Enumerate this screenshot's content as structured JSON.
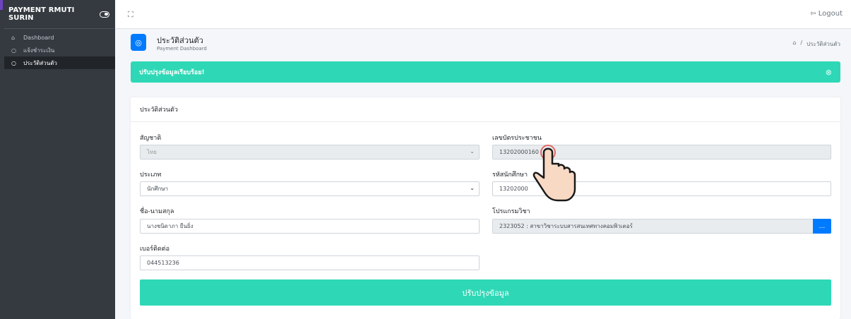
{
  "sidebar": {
    "brand": "PAYMENT RMUTI SURIN",
    "items": [
      {
        "label": "Dashboard",
        "icon": "home-icon"
      },
      {
        "label": "แจ้งชำระเงิน",
        "icon": "circle-icon"
      },
      {
        "label": "ประวัติส่วนตัว",
        "icon": "circle-icon"
      }
    ]
  },
  "topbar": {
    "logout_label": "Logout"
  },
  "header": {
    "title": "ประวัติส่วนตัว",
    "subtitle": "Payment Dashboard",
    "breadcrumb_sep": "/",
    "breadcrumb_current": "ประวัติส่วนตัว"
  },
  "alert": {
    "message": "ปรับปรุงข้อมูลเรียบร้อย!"
  },
  "form": {
    "card_title": "ประวัติส่วนตัว",
    "nationality_label": "สัญชาติ",
    "nationality_value": "ไทย",
    "id_card_label": "เลขบัตรประชาชน",
    "id_card_value": "13202000160",
    "type_label": "ประเภท",
    "type_value": "นักศึกษา",
    "student_id_label": "รหัสนักศึกษา",
    "student_id_value": "13202000",
    "fullname_label": "ชื่อ-นามสกุล",
    "fullname_value": "นางชนิดาภา ยืนยิ่ง",
    "program_label": "โปรแกรมวิชา",
    "program_value": "2323052 : สาขาวิชาระบบสารสนเทศทางคอมพิวเตอร์",
    "program_button": "...",
    "phone_label": "เบอร์ติดต่อ",
    "phone_value": "044513236",
    "submit_label": "ปรับปรุงข้อมูล"
  },
  "colors": {
    "sidebar_bg": "#343a40",
    "accent_teal": "#2ed8b6",
    "primary_blue": "#007bff"
  }
}
